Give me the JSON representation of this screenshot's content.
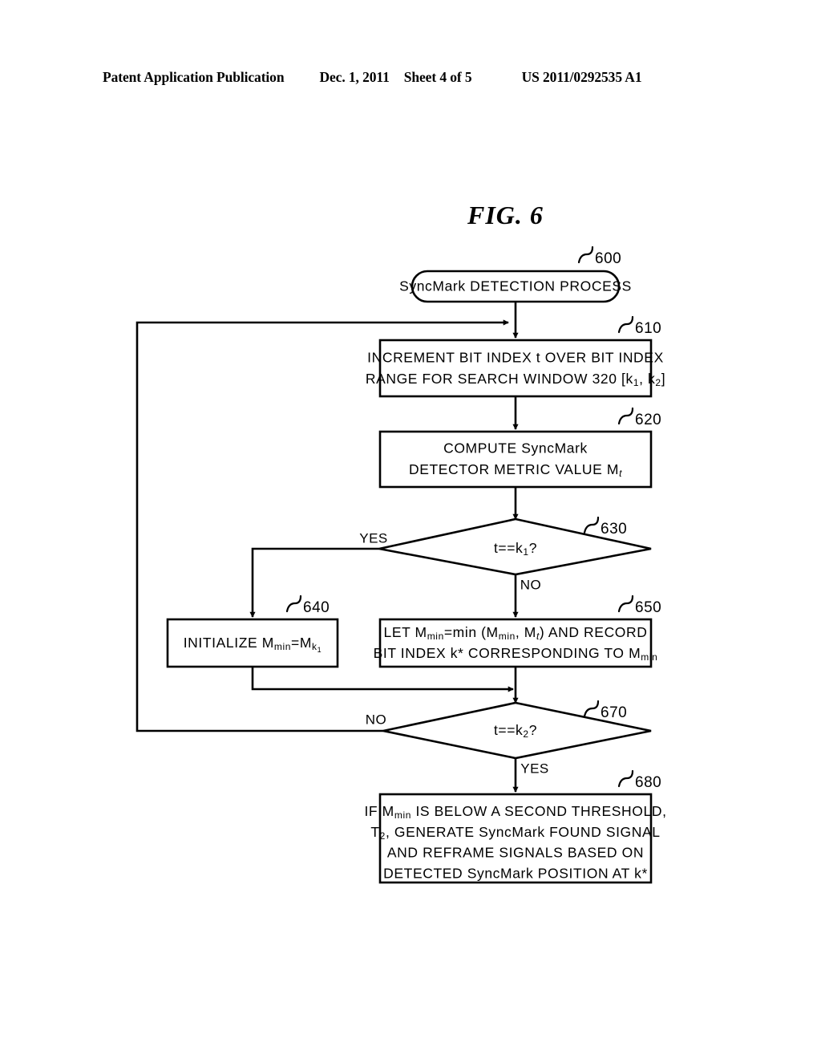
{
  "header": {
    "publication": "Patent Application Publication",
    "date": "Dec. 1, 2011",
    "sheet": "Sheet 4 of 5",
    "patent_number": "US 2011/0292535 A1"
  },
  "figure": {
    "title": "FIG.  6"
  },
  "nodes": {
    "start": {
      "ref": "600",
      "text": "SyncMark DETECTION PROCESS",
      "shape": "terminator"
    },
    "increment": {
      "ref": "610",
      "line1": "INCREMENT BIT INDEX t OVER BIT INDEX",
      "line2_a": "RANGE FOR SEARCH WINDOW 320 [k",
      "line2_sub1": "1",
      "line2_b": ", k",
      "line2_sub2": "2",
      "line2_c": "]",
      "shape": "process"
    },
    "compute": {
      "ref": "620",
      "line1": "COMPUTE SyncMark",
      "line2_a": "DETECTOR METRIC VALUE M",
      "line2_sub": "t",
      "shape": "process"
    },
    "decision_k1": {
      "ref": "630",
      "text_a": "t==k",
      "text_sub": "1",
      "text_b": "?",
      "shape": "decision",
      "yes_label": "YES",
      "no_label": "NO"
    },
    "initialize": {
      "ref": "640",
      "text_a": "INITIALIZE M",
      "text_sub1": "min",
      "text_b": "=M",
      "text_sub2": "k",
      "text_subsub": "1",
      "shape": "process"
    },
    "let_min": {
      "ref": "650",
      "line1_a": "LET M",
      "line1_sub1": "min",
      "line1_b": "=min (M",
      "line1_sub2": "min",
      "line1_c": ", M",
      "line1_sub3": "t",
      "line1_d": ") AND RECORD",
      "line2_a": "BIT INDEX k* CORRESPONDING TO M",
      "line2_sub": "min",
      "shape": "process"
    },
    "decision_k2": {
      "ref": "670",
      "text_a": "t==k",
      "text_sub": "2",
      "text_b": "?",
      "shape": "decision",
      "yes_label": "YES",
      "no_label": "NO"
    },
    "final": {
      "ref": "680",
      "line1_a": "IF M",
      "line1_sub": "min",
      "line1_b": " IS BELOW A SECOND THRESHOLD,",
      "line2_a": "T",
      "line2_sub": "2",
      "line2_b": ", GENERATE SyncMark FOUND SIGNAL",
      "line3": "AND REFRAME SIGNALS BASED ON",
      "line4": "DETECTED SyncMark POSITION AT k*",
      "shape": "process"
    }
  },
  "colors": {
    "ink": "#000000",
    "paper": "#ffffff"
  }
}
